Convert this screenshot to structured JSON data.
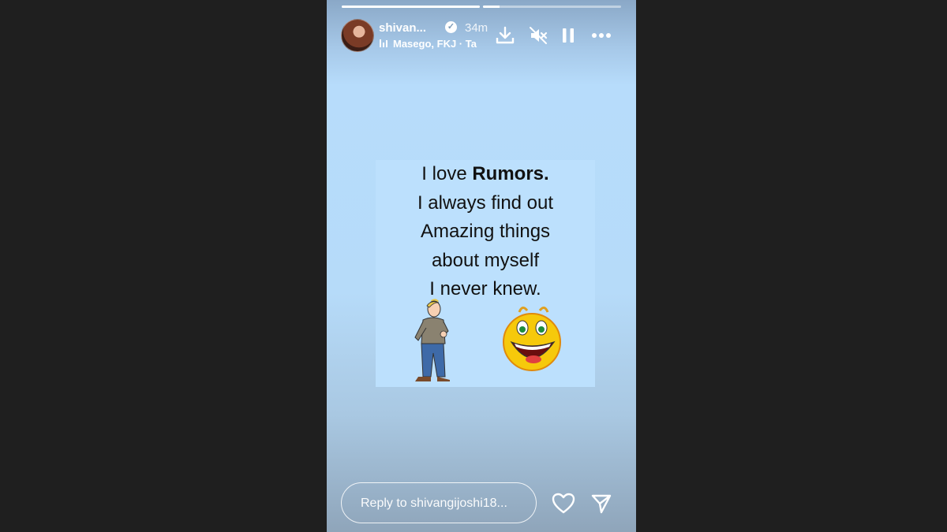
{
  "story": {
    "progress": [
      1.0,
      0.12
    ],
    "user": {
      "username": "shivan...",
      "time": "34m",
      "verified": true,
      "music": "Masego, FKJ · Ta"
    },
    "controls": [
      "download-icon",
      "mute-icon",
      "pause-icon",
      "more-icon"
    ],
    "quote": {
      "line1_pre": "I love ",
      "line1_bold": "Rumors.",
      "line2": "I always find out",
      "line3": "Amazing things",
      "line4": "about myself",
      "line5": "I never knew."
    },
    "reply": {
      "placeholder": "Reply to shivangijoshi18..."
    },
    "actions": [
      "heart-icon",
      "send-icon"
    ]
  },
  "colors": {
    "background": "#1f1f1f",
    "story_bg": "#b7dcfb",
    "text": "#111111",
    "overlay_text": "#ffffff"
  }
}
